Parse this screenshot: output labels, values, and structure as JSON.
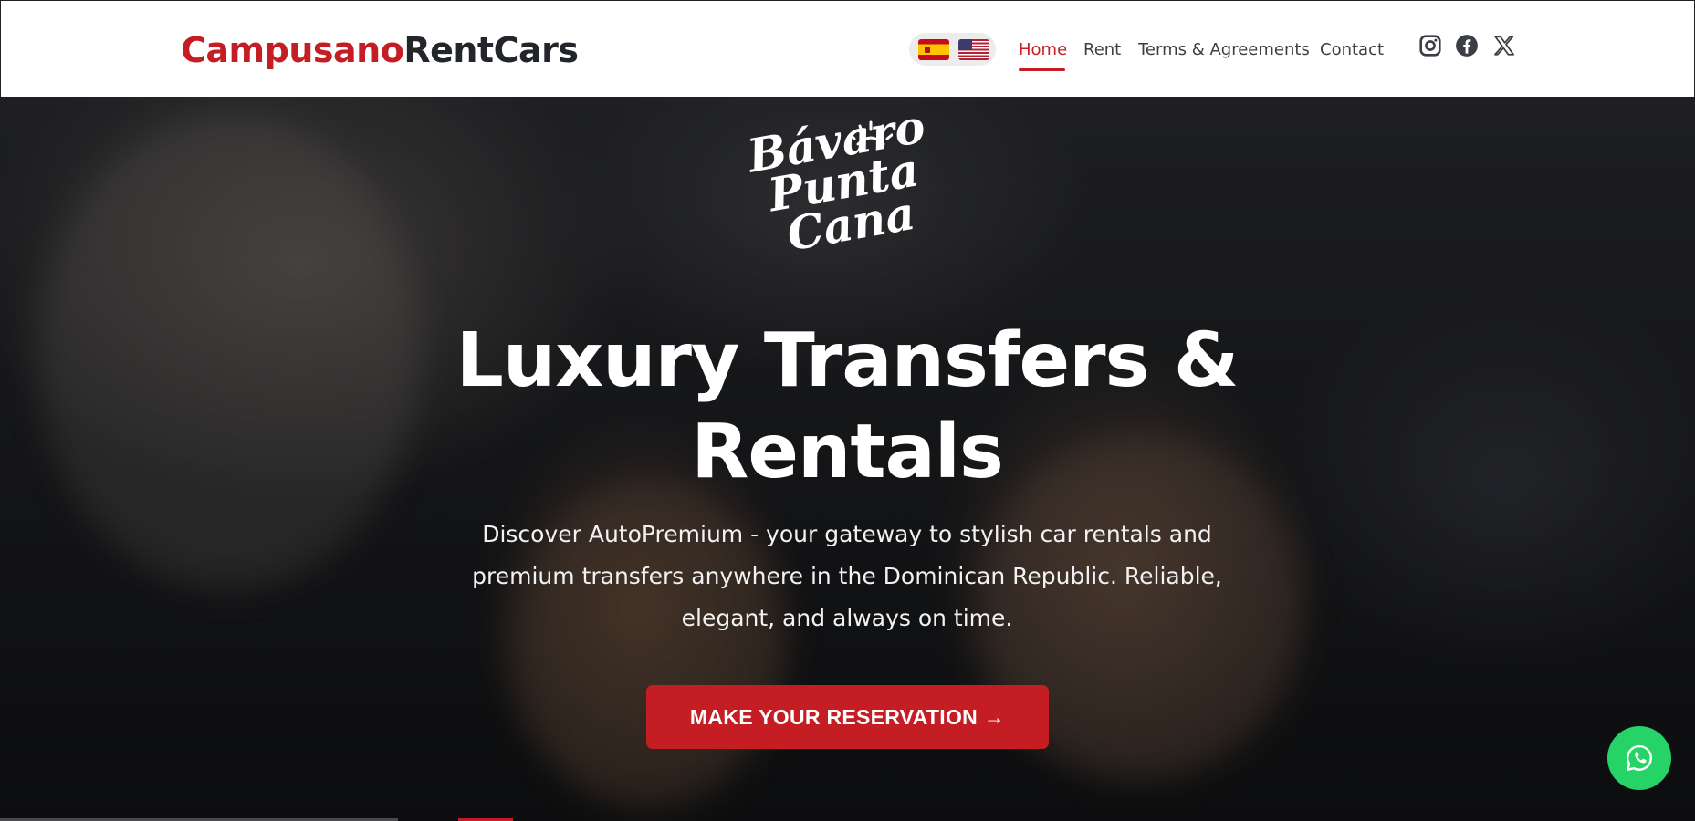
{
  "header": {
    "brand_part1": "Campusano",
    "brand_part2": "RentCars",
    "languages": [
      "es",
      "en"
    ],
    "nav": [
      {
        "label": "Home",
        "active": true
      },
      {
        "label": "Rent",
        "active": false
      },
      {
        "label": "Terms & Agreements",
        "active": false
      },
      {
        "label": "Contact",
        "active": false
      }
    ],
    "social_icons": [
      "instagram-icon",
      "facebook-icon",
      "x-icon"
    ]
  },
  "hero": {
    "logo_line1": "Bávaro",
    "logo_line2": "Punta",
    "logo_line3": "Cana",
    "title_line1": "Luxury Transfers &",
    "title_line2": "Rentals",
    "description": "Discover AutoPremium - your gateway to stylish car rentals and premium transfers anywhere in the Dominican Republic. Reliable, elegant, and always on time.",
    "cta_label": "MAKE YOUR RESERVATION →"
  },
  "floating": {
    "whatsapp_icon": "whatsapp-icon"
  },
  "colors": {
    "accent": "#c41e24",
    "brand_dark": "#22252a",
    "whatsapp": "#25d366"
  }
}
